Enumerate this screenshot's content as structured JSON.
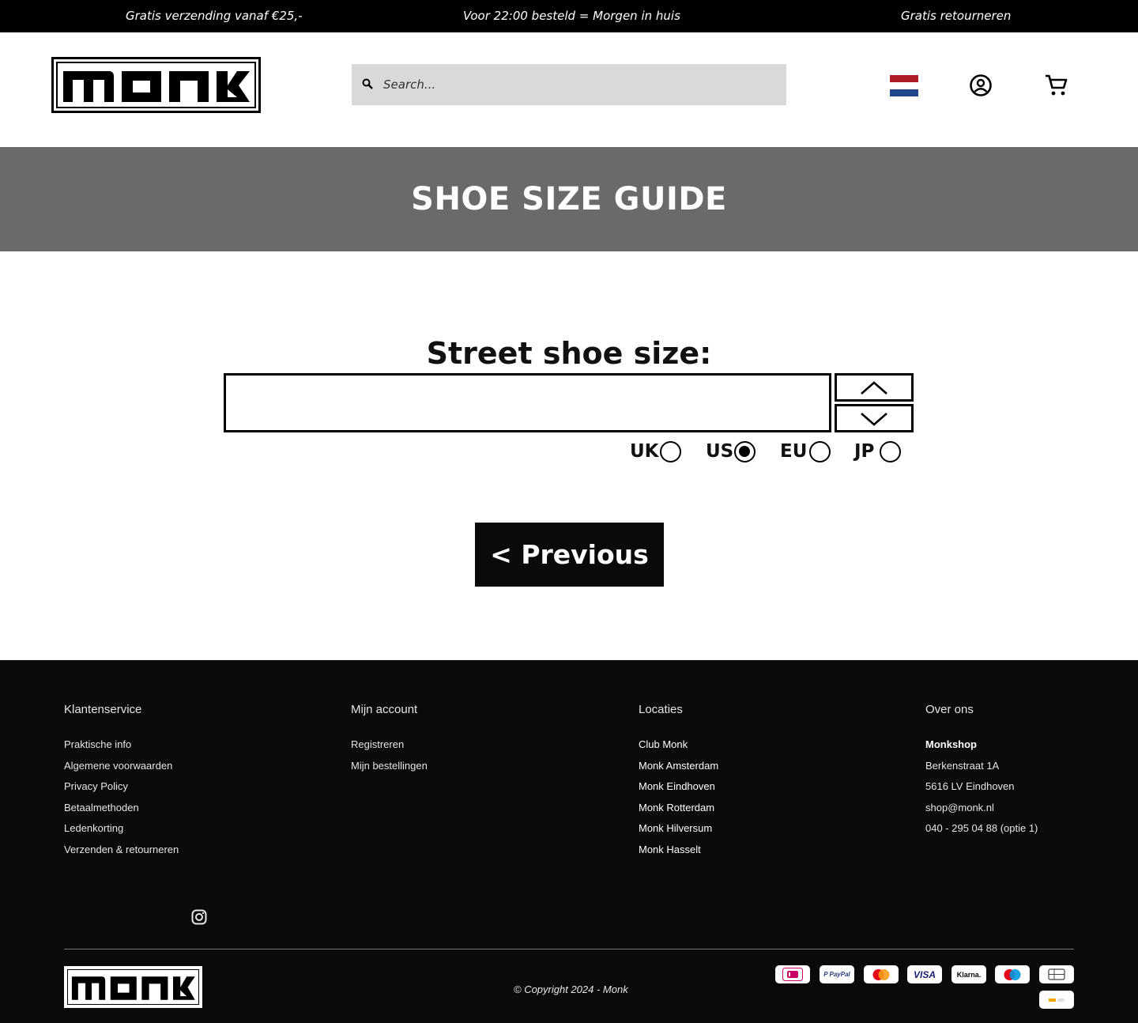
{
  "announcements": [
    "Gratis verzending vanaf €25,-",
    "Voor 22:00 besteld = Morgen in huis",
    "Gratis retourneren"
  ],
  "header": {
    "search_placeholder": "Search...",
    "flag_colors": [
      "#ae1c28",
      "#ffffff",
      "#21468b"
    ]
  },
  "banner": {
    "title": "SHOE SIZE GUIDE"
  },
  "form": {
    "label": "Street shoe size:",
    "value": "",
    "units": [
      {
        "label": "UK",
        "selected": false
      },
      {
        "label": "US",
        "selected": true
      },
      {
        "label": "EU",
        "selected": false
      },
      {
        "label": "JP",
        "selected": false
      }
    ],
    "previous_label": "< Previous"
  },
  "footer": {
    "columns": [
      {
        "title": "Klantenservice",
        "items": [
          "Praktische info",
          "Algemene voorwaarden",
          "Privacy Policy",
          "Betaalmethoden",
          "Ledenkorting",
          "Verzenden & retourneren"
        ]
      },
      {
        "title": "Mijn account",
        "items": [
          "Registreren",
          "Mijn bestellingen"
        ]
      },
      {
        "title": "Locaties",
        "items": [
          "Club Monk",
          "Monk Amsterdam",
          "Monk Eindhoven",
          "Monk Rotterdam",
          "Monk Hilversum",
          "Monk Hasselt"
        ]
      },
      {
        "title": "Over ons",
        "items": [
          "Monkshop",
          "Berkenstraat 1A",
          "5616 LV Eindhoven",
          "shop@monk.nl",
          "040 - 295 04 88 (optie 1)"
        ]
      }
    ],
    "copyright": "© Copyright 2024 - Monk",
    "payment_methods": [
      "iDEAL",
      "PayPal",
      "Mastercard",
      "VISA",
      "Klarna.",
      "Maestro",
      "Gift card",
      "Bancontact"
    ]
  }
}
